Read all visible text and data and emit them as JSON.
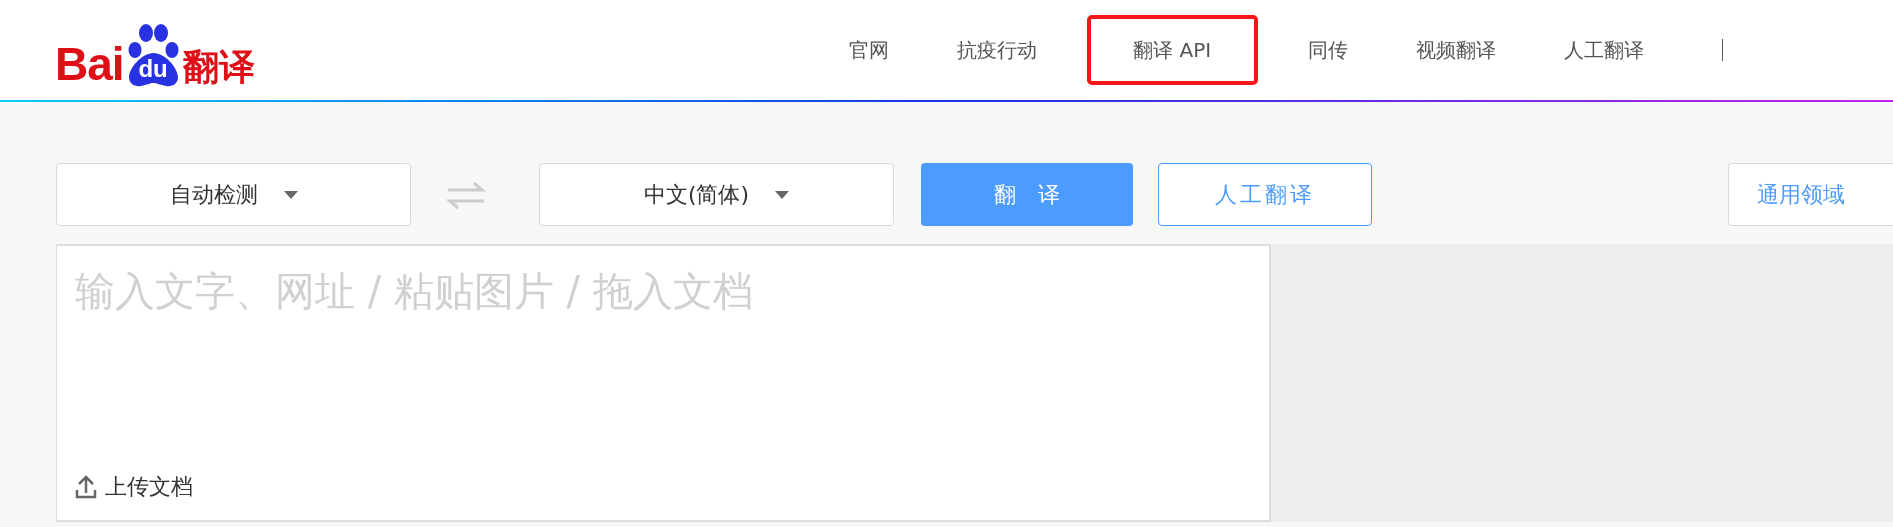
{
  "logo": {
    "text_left": "Bai",
    "paw_text": "du",
    "text_right": "翻译"
  },
  "nav": [
    {
      "label": "官网",
      "highlighted": false
    },
    {
      "label": "抗疫行动",
      "highlighted": false
    },
    {
      "label": "翻译 API",
      "highlighted": true
    },
    {
      "label": "同传",
      "highlighted": false
    },
    {
      "label": "视频翻译",
      "highlighted": false
    },
    {
      "label": "人工翻译",
      "highlighted": false
    }
  ],
  "source_language": {
    "value": "自动检测"
  },
  "target_language": {
    "value": "中文(简体)"
  },
  "translate_button": "翻　译",
  "human_translate_button": "人工翻译",
  "domain_button": "通用领域",
  "input": {
    "placeholder": "输入文字、网址 / 粘贴图片 / 拖入文档"
  },
  "upload": "上传文档"
}
